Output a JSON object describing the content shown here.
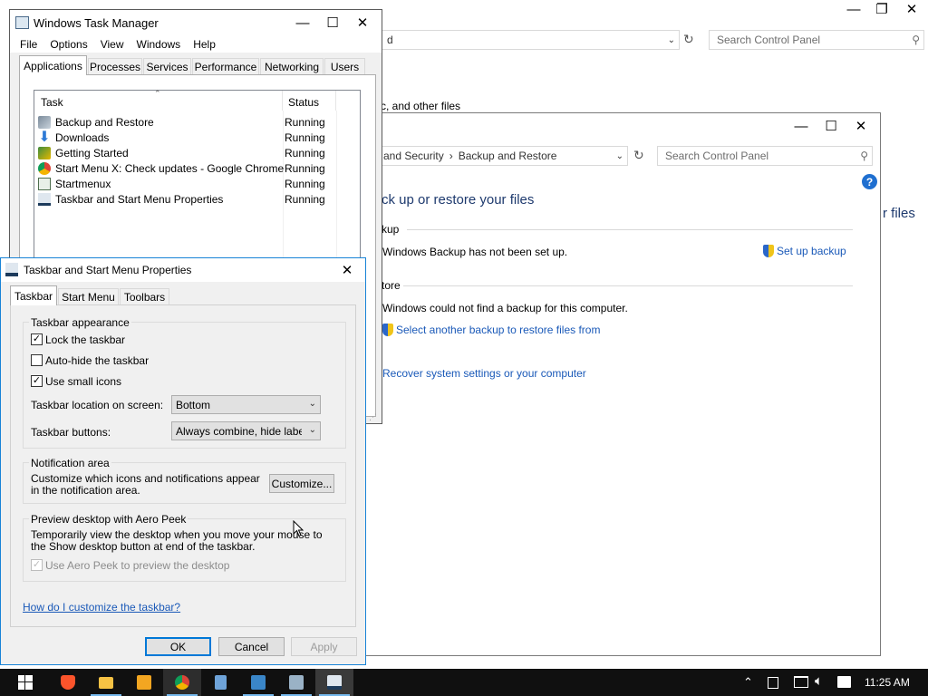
{
  "back_window": {
    "address_partial": "d",
    "search_placeholder": "Search Control Panel",
    "partial_text": "c, and other files",
    "partial_right": "r files"
  },
  "backup_window": {
    "breadcrumb_1": "and Security",
    "breadcrumb_sep": "›",
    "breadcrumb_2": "Backup and Restore",
    "search_placeholder": "Search Control Panel",
    "heading": "ck up or restore your files",
    "backup_section": "kup",
    "backup_status": "Windows Backup has not been set up.",
    "setup_link": "Set up backup",
    "restore_section": "tore",
    "restore_status": "Windows could not find a backup for this computer.",
    "select_backup_link": "Select another backup to restore files from",
    "recover_link": "Recover system settings or your computer",
    "help_glyph": "?"
  },
  "task_manager": {
    "title": "Windows Task Manager",
    "menu": [
      "File",
      "Options",
      "View",
      "Windows",
      "Help"
    ],
    "tabs": [
      "Applications",
      "Processes",
      "Services",
      "Performance",
      "Networking",
      "Users"
    ],
    "col_task": "Task",
    "col_status": "Status",
    "tasks": [
      {
        "name": "Backup and Restore",
        "status": "Running",
        "icon": "backup-icon"
      },
      {
        "name": "Downloads",
        "status": "Running",
        "icon": "download-arrow-icon"
      },
      {
        "name": "Getting Started",
        "status": "Running",
        "icon": "getting-started-icon"
      },
      {
        "name": "Start Menu X: Check updates - Google Chrome",
        "status": "Running",
        "icon": "chrome-icon"
      },
      {
        "name": "Startmenux",
        "status": "Running",
        "icon": "window-icon"
      },
      {
        "name": "Taskbar and Start Menu Properties",
        "status": "Running",
        "icon": "taskbar-properties-icon"
      }
    ]
  },
  "props_dialog": {
    "title": "Taskbar and Start Menu Properties",
    "tabs": [
      "Taskbar",
      "Start Menu",
      "Toolbars"
    ],
    "appearance_group": "Taskbar appearance",
    "lock_label": "Lock the taskbar",
    "lock_checked": true,
    "autohide_label": "Auto-hide the taskbar",
    "autohide_checked": false,
    "small_icons_label": "Use small icons",
    "small_icons_checked": true,
    "location_label": "Taskbar location on screen:",
    "location_value": "Bottom",
    "buttons_label": "Taskbar buttons:",
    "buttons_value": "Always combine, hide labels",
    "notification_group": "Notification area",
    "notification_text_1": "Customize which icons and notifications appear",
    "notification_text_2": "in the notification area.",
    "customize_button": "Customize...",
    "peek_group": "Preview desktop with Aero Peek",
    "peek_text_1": "Temporarily view the desktop when you move your mouse to",
    "peek_text_2": "the Show desktop button at end of the taskbar.",
    "peek_checkbox_label": "Use Aero Peek to preview the desktop",
    "peek_checked": true,
    "help_link": "How do I customize the taskbar?",
    "ok_button": "OK",
    "cancel_button": "Cancel",
    "apply_button": "Apply"
  },
  "taskbar": {
    "clock": "11:25 AM"
  },
  "colors": {
    "link": "#1a59b8",
    "taskbar_bg": "#101010",
    "accent": "#0078d7"
  }
}
